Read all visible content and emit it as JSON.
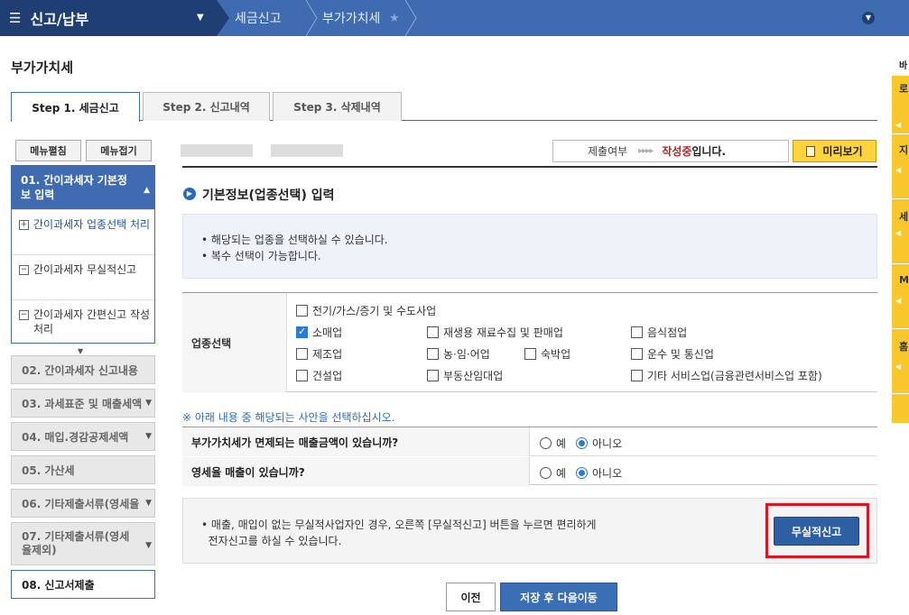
{
  "topbar": {
    "menu_label": "신고/납부",
    "breadcrumbs": [
      "세금신고",
      "부가가치세"
    ]
  },
  "page_title": "부가가치세",
  "steps": [
    "Step 1. 세금신고",
    "Step 2. 신고내역",
    "Step 3. 삭제내역"
  ],
  "sidebar": {
    "expand_all": "메뉴펼침",
    "collapse_all": "메뉴접기",
    "current": {
      "title": "01. 간이과세자 기본정보 입력",
      "subitems": [
        "간이과세자 업종선택 처리",
        "간이과세자 무실적신고",
        "간이과세자 간편신고 작성 처리"
      ]
    },
    "items": [
      "02. 간이과세자 신고내용",
      "03. 과세표준 및 매출세액",
      "04. 매입.경감공제세액",
      "05. 가산세",
      "06. 기타제출서류(영세율",
      "07. 기타제출서류(영세율제외)",
      "08. 신고서제출"
    ]
  },
  "status": {
    "label": "제출여부",
    "arrows": "▸▸▸▸",
    "value": "작성중",
    "suffix": "입니다."
  },
  "preview_button": "미리보기",
  "section_title": "기본정보(업종선택) 입력",
  "info": [
    "해당되는 업종을 선택하실 수 있습니다.",
    "복수 선택이 가능합니다."
  ],
  "industry": {
    "label": "업종선택",
    "options": [
      {
        "label": "전기/가스/증기 및 수도사업",
        "checked": false
      },
      {
        "label": "소매업",
        "checked": true
      },
      {
        "label": "재생용 재료수집 및 판매업",
        "checked": false
      },
      {
        "label": "음식점업",
        "checked": false
      },
      {
        "label": "제조업",
        "checked": false
      },
      {
        "label": "농·임·어업",
        "checked": false
      },
      {
        "label": "숙박업",
        "checked": false
      },
      {
        "label": "운수 및 통신업",
        "checked": false
      },
      {
        "label": "건설업",
        "checked": false
      },
      {
        "label": "부동산임대업",
        "checked": false
      },
      {
        "label": "기타 서비스업(금융관련서비스업 포함)",
        "checked": false
      }
    ]
  },
  "note": "※ 아래 내용 중 해당되는 사안을 선택하십시오.",
  "questions": [
    {
      "label": "부가가치세가 면제되는 매출금액이 있습니까?",
      "yes": "예",
      "no": "아니오",
      "selected": "아니오"
    },
    {
      "label": "영세율 매출이 있습니까?",
      "yes": "예",
      "no": "아니오",
      "selected": "아니오"
    }
  ],
  "nil_notice": [
    "매출, 매입이 없는 무실적사업자인 경우, 오른쪽 [무실적신고] 버튼을 누르면 편리하게",
    "전자신고를 하실 수 있습니다."
  ],
  "nil_button": "무실적신고",
  "prev_button": "이전",
  "save_button": "저장 후 다음이동",
  "right_strip": {
    "top": "바",
    "labels": [
      "로",
      "지",
      "세",
      "M",
      "홈"
    ]
  },
  "colors": {
    "primary": "#3f6cb1",
    "highlight": "#e0141e",
    "status": "#c0221b",
    "preview": "#ffd33d"
  }
}
